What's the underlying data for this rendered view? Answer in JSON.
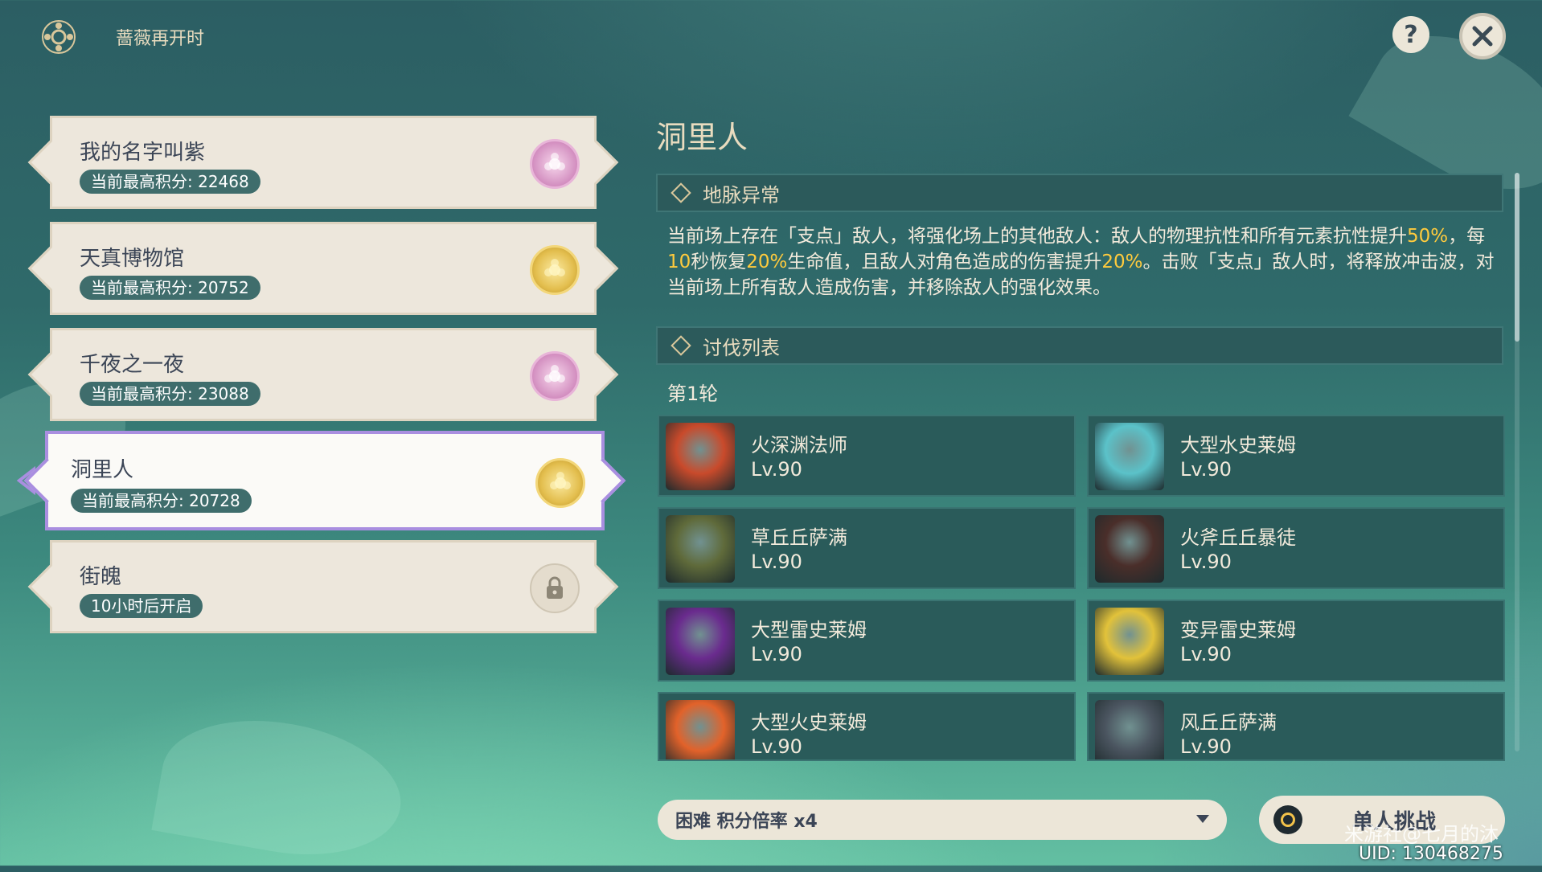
{
  "header": {
    "event_name": "蔷薇再开时"
  },
  "floors": [
    {
      "name": "我的名字叫紫",
      "score": "当前最高积分: 22468",
      "medal": "pink-rose"
    },
    {
      "name": "天真博物馆",
      "score": "当前最高积分: 20752",
      "medal": "gold-rose"
    },
    {
      "name": "千夜之一夜",
      "score": "当前最高积分: 23088",
      "medal": "pink-rose"
    },
    {
      "name": "洞里人",
      "score": "当前最高积分: 20728",
      "medal": "gold-rose",
      "selected": true
    },
    {
      "name": "街魄",
      "score": "10小时后开启",
      "medal": "lock"
    }
  ],
  "stage": {
    "title": "洞里人",
    "ley_title": "地脉异常",
    "ley_text": {
      "t1": "当前场上存在「支点」敌人，将强化场上的其他敌人：敌人的物理抗性和所有元素抗性提升",
      "h1": "50%",
      "t2": "，每",
      "h2": "10",
      "t3": "秒恢复",
      "h3": "20%",
      "t4": "生命值，且敌人对角色造成的伤害提升",
      "h4": "20%",
      "t5": "。击败「支点」敌人时，将释放冲击波，对当前场上所有敌人造成伤害，并移除敌人的强化效果。"
    },
    "list_title": "讨伐列表",
    "round_label": "第1轮",
    "enemies": [
      {
        "name": "火深渊法师",
        "level": "Lv.90",
        "color": "#c94a2b"
      },
      {
        "name": "大型水史莱姆",
        "level": "Lv.90",
        "color": "#5bc2c9"
      },
      {
        "name": "草丘丘萨满",
        "level": "Lv.90",
        "color": "#5f6a3a"
      },
      {
        "name": "火斧丘丘暴徒",
        "level": "Lv.90",
        "color": "#4a2e2a"
      },
      {
        "name": "大型雷史莱姆",
        "level": "Lv.90",
        "color": "#6a2b8e"
      },
      {
        "name": "变异雷史莱姆",
        "level": "Lv.90",
        "color": "#e2c23a"
      },
      {
        "name": "大型火史莱姆",
        "level": "Lv.90",
        "color": "#e2622a"
      },
      {
        "name": "风丘丘萨满",
        "level": "Lv.90",
        "color": "#4b5560"
      }
    ]
  },
  "footer": {
    "difficulty": "困难 积分倍率 x4",
    "start_label": "单人挑战",
    "watermark": "米游社@七月的沐",
    "uid": "UID: 130468275"
  }
}
